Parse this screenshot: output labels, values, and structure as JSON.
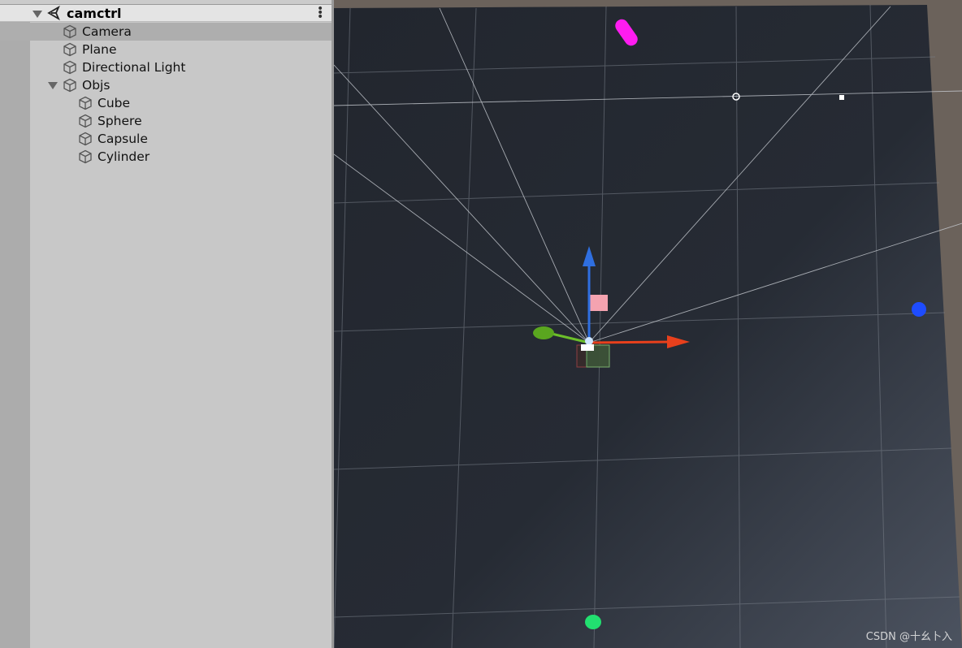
{
  "hierarchy": {
    "scene_name": "camctrl",
    "items": [
      {
        "label": "Camera",
        "depth": 1,
        "selected": true
      },
      {
        "label": "Plane",
        "depth": 1
      },
      {
        "label": "Directional Light",
        "depth": 1
      },
      {
        "label": "Objs",
        "depth": 1,
        "expanded": true
      },
      {
        "label": "Cube",
        "depth": 2
      },
      {
        "label": "Sphere",
        "depth": 2
      },
      {
        "label": "Capsule",
        "depth": 2
      },
      {
        "label": "Cylinder",
        "depth": 2
      }
    ],
    "menu_icon": "kebab-menu-icon",
    "item_icon": "gameobject-cube-icon"
  },
  "scene_view": {
    "background": "#252a33",
    "gizmo_colors": {
      "x": "#e8401c",
      "y": "#6cbf2a",
      "z": "#2f6fe0"
    },
    "objects": {
      "capsule": "#ff1cf0",
      "sphere": "#1e4cff",
      "cylinder": "#22e070",
      "cube": "#f4a3b0"
    }
  },
  "watermark": "CSDN @十幺卜入"
}
